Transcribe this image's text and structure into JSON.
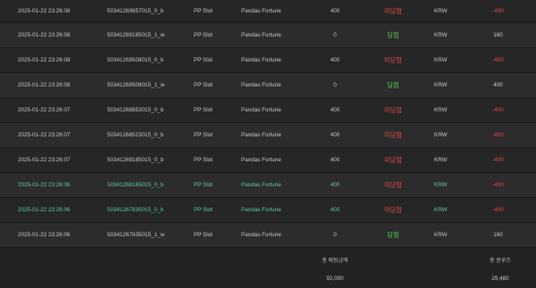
{
  "rows": [
    {
      "time": "2025-01-22 23:26:08",
      "id": "50341269857015_0_b",
      "game": "PP Slot",
      "name": "Pandas Fortune",
      "bet": "400",
      "result": "미당첨",
      "result_type": "lose",
      "currency": "KRW",
      "win": "-400",
      "highlight": false
    },
    {
      "time": "2025-01-22 23:26:08",
      "id": "50341269185015_1_w",
      "game": "PP Slot",
      "name": "Pandas Fortune",
      "bet": "0",
      "result": "당첨",
      "result_type": "win",
      "currency": "KRW",
      "win": "160",
      "highlight": false
    },
    {
      "time": "2025-01-22 23:26:08",
      "id": "50341269508015_0_b",
      "game": "PP Slot",
      "name": "Pandas Fortune",
      "bet": "400",
      "result": "미당첨",
      "result_type": "lose",
      "currency": "KRW",
      "win": "-400",
      "highlight": false
    },
    {
      "time": "2025-01-22 23:26:08",
      "id": "50341269508015_1_w",
      "game": "PP Slot",
      "name": "Pandas Fortune",
      "bet": "0",
      "result": "당첨",
      "result_type": "win",
      "currency": "KRW",
      "win": "400",
      "highlight": false
    },
    {
      "time": "2025-01-22 23:26:07",
      "id": "50341268853015_0_b",
      "game": "PP Slot",
      "name": "Pandas Fortune",
      "bet": "400",
      "result": "미당첨",
      "result_type": "lose",
      "currency": "KRW",
      "win": "-400",
      "highlight": false
    },
    {
      "time": "2025-01-22 23:26:07",
      "id": "50341268523015_0_b",
      "game": "PP Slot",
      "name": "Pandas Fortune",
      "bet": "400",
      "result": "미당첨",
      "result_type": "lose",
      "currency": "KRW",
      "win": "-400",
      "highlight": false
    },
    {
      "time": "2025-01-22 23:26:07",
      "id": "50341269185015_0_b",
      "game": "PP Slot",
      "name": "Pandas Fortune",
      "bet": "400",
      "result": "미당첨",
      "result_type": "lose",
      "currency": "KRW",
      "win": "-400",
      "highlight": false
    },
    {
      "time": "2025-01-22 23:26:06",
      "id": "50341268165015_0_b",
      "game": "PP Slot",
      "name": "Pandas Fortune",
      "bet": "400",
      "result": "미당첨",
      "result_type": "lose",
      "currency": "KRW",
      "win": "-400",
      "highlight": true
    },
    {
      "time": "2025-01-22 23:26:06",
      "id": "50341267835015_0_b",
      "game": "PP Slot",
      "name": "Pandas Fortune",
      "bet": "400",
      "result": "미당첨",
      "result_type": "lose",
      "currency": "KRW",
      "win": "-400",
      "highlight": true
    },
    {
      "time": "2025-01-22 23:26:06",
      "id": "50341267835015_1_w",
      "game": "PP Slot",
      "name": "Pandas Fortune",
      "bet": "0",
      "result": "당첨",
      "result_type": "win",
      "currency": "KRW",
      "win": "160",
      "highlight": false
    }
  ],
  "summary": {
    "total_bet_label": "총 배팅금액",
    "total_bet_value": "92,000",
    "total_win_label": "총 윈루즈",
    "total_win_value": "29,480"
  },
  "colors": {
    "lose": "#e04a4a",
    "win": "#56d24a",
    "highlight_row_text": "#62c6a4"
  }
}
